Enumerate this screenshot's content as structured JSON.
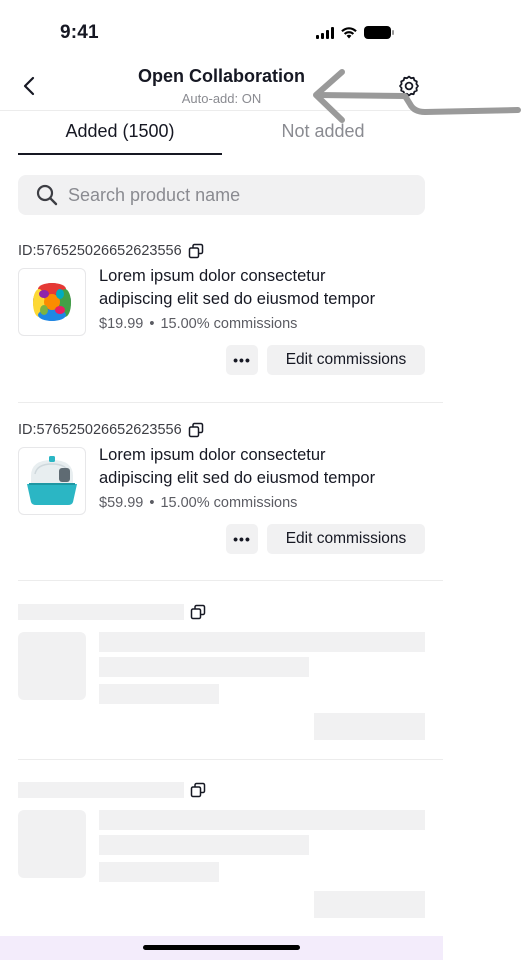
{
  "status_bar": {
    "time": "9:41"
  },
  "nav": {
    "title": "Open Collaboration",
    "subtitle": "Auto-add: ON"
  },
  "tabs": [
    {
      "label": "Added (1500)",
      "active": true
    },
    {
      "label": "Not added",
      "active": false
    }
  ],
  "search": {
    "placeholder": "Search product name"
  },
  "products": [
    {
      "id": "ID:576525026652623556",
      "title_line1": "Lorem ipsum dolor consectetur",
      "title_line2": "adipiscing elit sed do eiusmod tempor",
      "price": "$19.99",
      "commission": "15.00% commissions",
      "image": "colorful-knot-ball",
      "more_label": "•••",
      "edit_label": "Edit commissions"
    },
    {
      "id": "ID:576525026652623556",
      "title_line1": "Lorem ipsum dolor consectetur",
      "title_line2": "adipiscing elit sed do eiusmod tempor",
      "price": "$59.99",
      "commission": "15.00% commissions",
      "image": "covered-litter-box",
      "more_label": "•••",
      "edit_label": "Edit commissions"
    }
  ],
  "colors": {
    "text_primary": "#161823",
    "text_secondary": "#8a8b91",
    "surface": "#f1f1f2",
    "bottom_bar": "#f3ecfb",
    "annotation_arrow": "#9a9a9a"
  }
}
